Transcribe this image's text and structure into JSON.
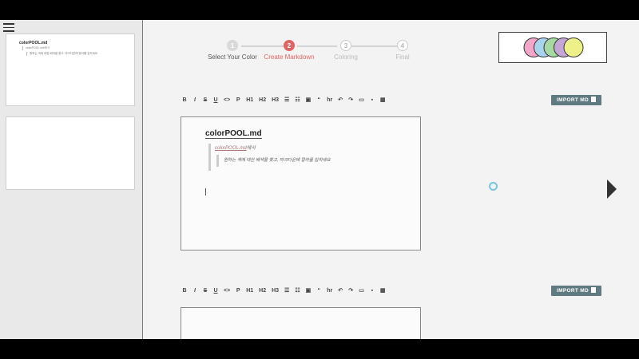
{
  "sidebar": {
    "thumb1": {
      "title": "colorPOOL.md",
      "quote1": "colorPOOL.md에서",
      "quote2": "원하는 색에 대한 배색을 찾고, 마크다운에 칼라를 입히세요"
    }
  },
  "stepper": {
    "steps": [
      {
        "num": "1",
        "label": "Select Your Color",
        "state": "done"
      },
      {
        "num": "2",
        "label": "Create Markdown",
        "state": "active"
      },
      {
        "num": "3",
        "label": "Coloring",
        "state": "todo"
      },
      {
        "num": "4",
        "label": "Final",
        "state": "todo"
      }
    ]
  },
  "palette": {
    "colors": [
      "#f2a7c9",
      "#a9d4ee",
      "#a8d9a2",
      "#c6a6d6",
      "#eef08a"
    ]
  },
  "toolbar": {
    "items": [
      "B",
      "I",
      "S",
      "U",
      "<>",
      "P",
      "H1",
      "H2",
      "H3",
      "ul",
      "ol",
      "link",
      "“",
      "hr",
      "undo",
      "redo",
      "image",
      "img",
      "table"
    ],
    "import_label": "IMPORT MD"
  },
  "editor1": {
    "heading": "colorPOOL.md",
    "quote_link": "colorPOOL.md",
    "quote_suffix": "에서",
    "nested_quote": "원하는 색에 대한 배색을 찾고, 마크다운에 칼라를 입히세요"
  },
  "colors": {
    "accent": "#e06666",
    "button": "#5f7a80"
  }
}
